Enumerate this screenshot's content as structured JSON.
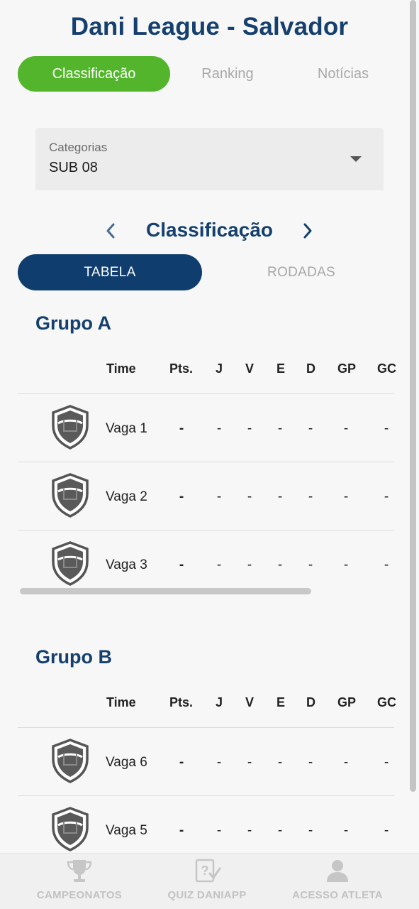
{
  "app": {
    "title": "Dani League - Salvador"
  },
  "top_tabs": [
    {
      "label": "Classificação",
      "active": true
    },
    {
      "label": "Ranking",
      "active": false
    },
    {
      "label": "Notícias",
      "active": false
    }
  ],
  "category_select": {
    "label": "Categorias",
    "value": "SUB 08"
  },
  "section": {
    "title": "Classificação"
  },
  "sub_tabs": [
    {
      "label": "TABELA",
      "active": true
    },
    {
      "label": "RODADAS",
      "active": false
    }
  ],
  "table_headers": [
    "Time",
    "Pts.",
    "J",
    "V",
    "E",
    "D",
    "GP",
    "GC"
  ],
  "groups": [
    {
      "name": "Grupo A",
      "rows": [
        {
          "team": "Vaga 1",
          "pts": "-",
          "j": "-",
          "v": "-",
          "e": "-",
          "d": "-",
          "gp": "-",
          "gc": "-"
        },
        {
          "team": "Vaga 2",
          "pts": "-",
          "j": "-",
          "v": "-",
          "e": "-",
          "d": "-",
          "gp": "-",
          "gc": "-"
        },
        {
          "team": "Vaga 3",
          "pts": "-",
          "j": "-",
          "v": "-",
          "e": "-",
          "d": "-",
          "gp": "-",
          "gc": "-"
        }
      ]
    },
    {
      "name": "Grupo B",
      "rows": [
        {
          "team": "Vaga 6",
          "pts": "-",
          "j": "-",
          "v": "-",
          "e": "-",
          "d": "-",
          "gp": "-",
          "gc": "-"
        },
        {
          "team": "Vaga 5",
          "pts": "-",
          "j": "-",
          "v": "-",
          "e": "-",
          "d": "-",
          "gp": "-",
          "gc": "-"
        }
      ]
    }
  ],
  "bottom_nav": [
    {
      "label": "CAMPEONATOS",
      "icon": "trophy-icon"
    },
    {
      "label": "QUIZ DANIAPP",
      "icon": "quiz-icon"
    },
    {
      "label": "ACESSO ATLETA",
      "icon": "user-icon"
    }
  ],
  "colors": {
    "primary": "#15406e",
    "accent": "#52b52b",
    "sub_tab_active": "#0f3d6e",
    "inactive_text": "#a9a9a9"
  }
}
